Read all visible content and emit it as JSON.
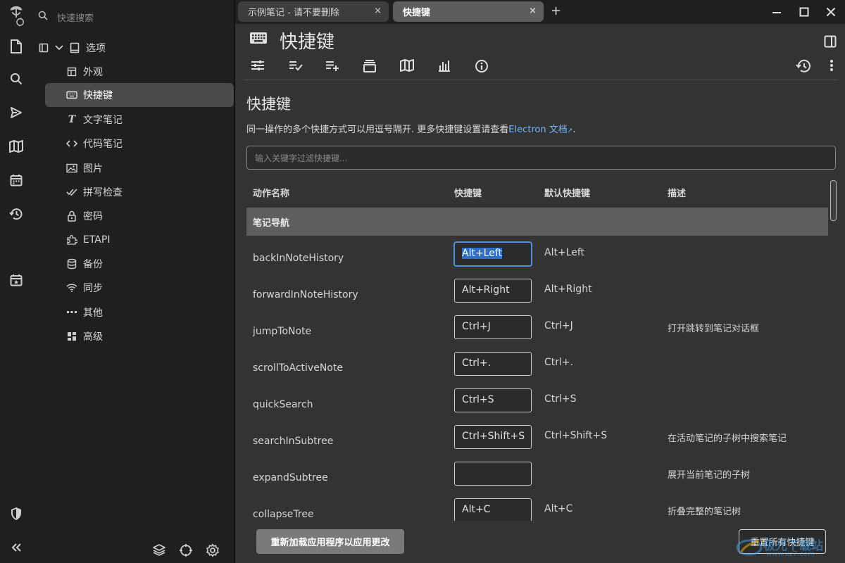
{
  "search": {
    "placeholder": "快速搜索"
  },
  "tree": {
    "root_label": "选项",
    "items": [
      {
        "label": "外观"
      },
      {
        "label": "快捷键"
      },
      {
        "label": "文字笔记"
      },
      {
        "label": "代码笔记"
      },
      {
        "label": "图片"
      },
      {
        "label": "拼写检查"
      },
      {
        "label": "密码"
      },
      {
        "label": "ETAPI"
      },
      {
        "label": "备份"
      },
      {
        "label": "同步"
      },
      {
        "label": "其他"
      },
      {
        "label": "高级"
      }
    ]
  },
  "tabs": [
    {
      "label": "示例笔记 - 请不要删除",
      "close": "×"
    },
    {
      "label": "快捷键",
      "close": "×"
    }
  ],
  "new_tab": "+",
  "note": {
    "title": "快捷键"
  },
  "page": {
    "heading": "快捷键",
    "description_prefix": "同一操作的多个快捷方式可以用逗号隔开. 更多快捷键设置请查看",
    "description_link": "Electron 文档",
    "description_link_arrow": "↗",
    "description_suffix": ".",
    "filter_placeholder": "输入关键字过滤快捷键..."
  },
  "table": {
    "headers": {
      "name": "动作名称",
      "shortcut": "快捷键",
      "default": "默认快捷键",
      "description": "描述"
    },
    "section": "笔记导航",
    "rows": [
      {
        "name": "backInNoteHistory",
        "shortcut": "Alt+Left",
        "default": "Alt+Left",
        "description": ""
      },
      {
        "name": "forwardInNoteHistory",
        "shortcut": "Alt+Right",
        "default": "Alt+Right",
        "description": ""
      },
      {
        "name": "jumpToNote",
        "shortcut": "Ctrl+J",
        "default": "Ctrl+J",
        "description": "打开跳转到笔记对话框"
      },
      {
        "name": "scrollToActiveNote",
        "shortcut": "Ctrl+.",
        "default": "Ctrl+.",
        "description": ""
      },
      {
        "name": "quickSearch",
        "shortcut": "Ctrl+S",
        "default": "Ctrl+S",
        "description": ""
      },
      {
        "name": "searchInSubtree",
        "shortcut": "Ctrl+Shift+S",
        "default": "Ctrl+Shift+S",
        "description": "在活动笔记的子树中搜索笔记"
      },
      {
        "name": "expandSubtree",
        "shortcut": "",
        "default": "",
        "description": "展开当前笔记的子树"
      },
      {
        "name": "collapseTree",
        "shortcut": "Alt+C",
        "default": "Alt+C",
        "description": "折叠完整的笔记树"
      }
    ]
  },
  "buttons": {
    "reload": "重新加载应用程序以应用更改",
    "reset": "重置所有快捷键"
  },
  "watermark": {
    "text": "极光下载站",
    "sub": "www.xz7.com"
  }
}
